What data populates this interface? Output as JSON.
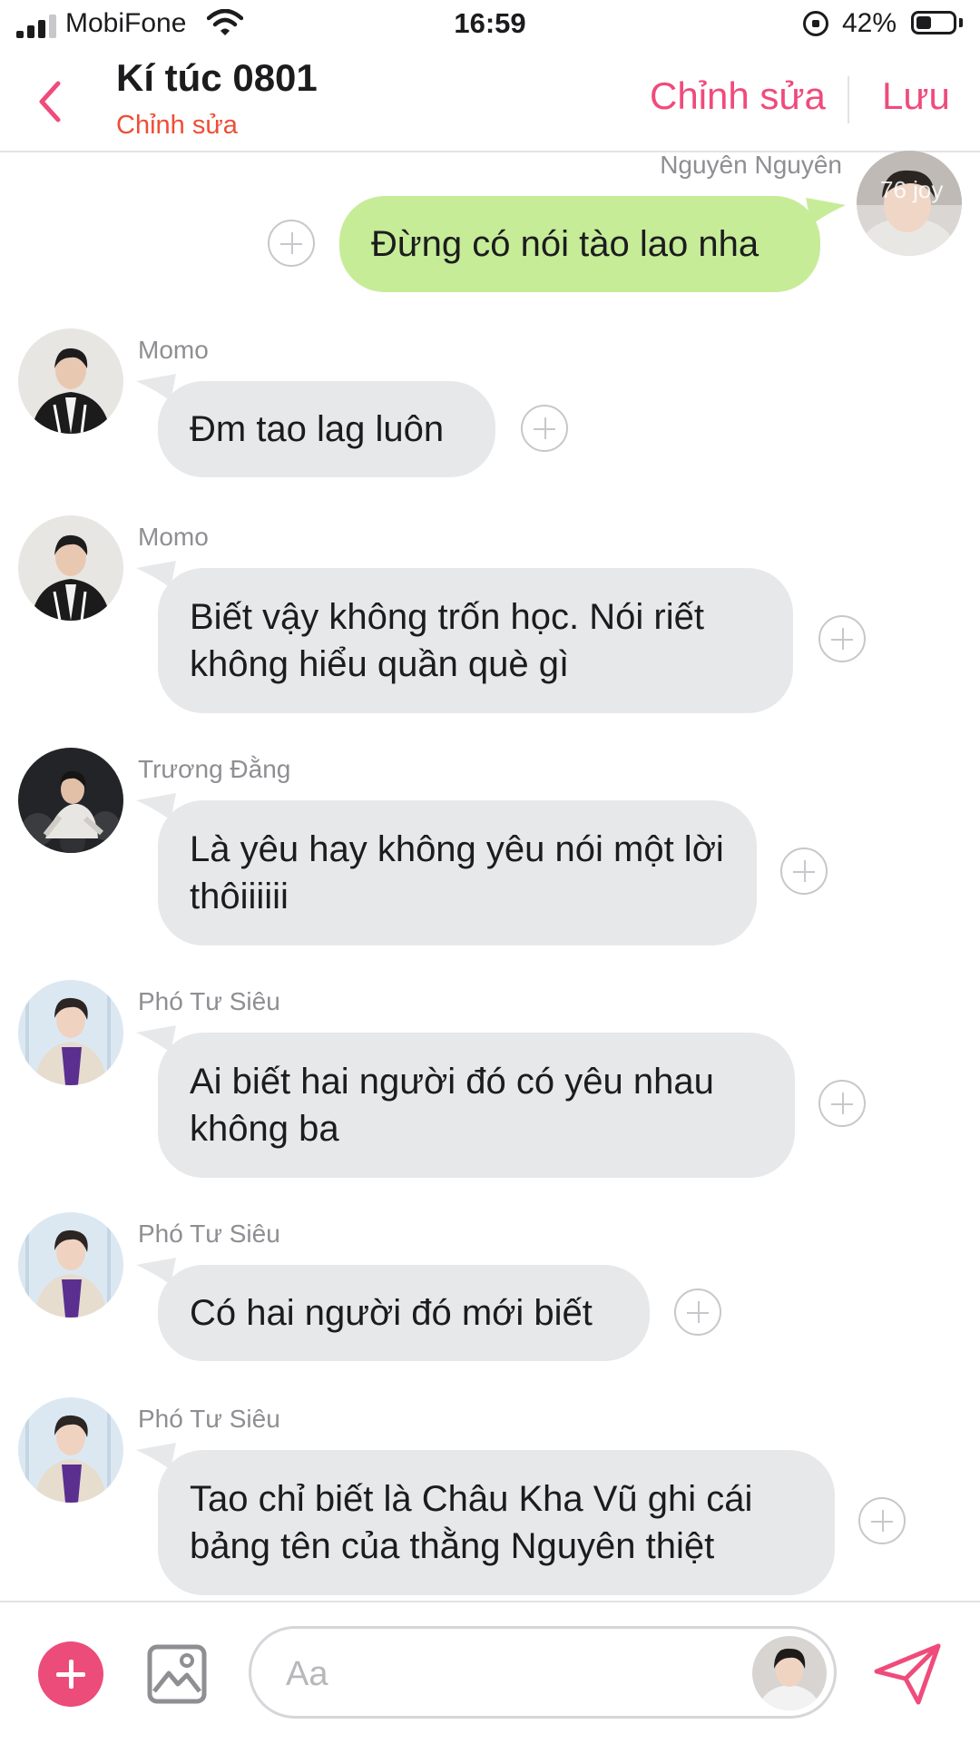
{
  "status_bar": {
    "carrier": "MobiFone",
    "time": "16:59",
    "battery_percent": "42%",
    "battery_level": 0.42
  },
  "header": {
    "title": "Kí túc 0801",
    "subtitle": "Chỉnh sửa",
    "edit_label": "Chỉnh sửa",
    "save_label": "Lưu",
    "accent_color": "#ef4b7b"
  },
  "messages": [
    {
      "sender": "Nguyên Nguyên",
      "text": "Đừng có nói tào lao nha",
      "outgoing": true,
      "avatar_watermark": "76 joy"
    },
    {
      "sender": "Momo",
      "text": "Đm tao lag luôn",
      "outgoing": false
    },
    {
      "sender": "Momo",
      "text": "Biết vậy không trốn học. Nói riết không hiểu quần què gì",
      "outgoing": false
    },
    {
      "sender": "Trương Đằng",
      "text": "Là yêu hay không yêu nói một lời thôiiiiii",
      "outgoing": false
    },
    {
      "sender": "Phó Tư Siêu",
      "text": "Ai biết hai người đó có yêu nhau không ba",
      "outgoing": false
    },
    {
      "sender": "Phó Tư Siêu",
      "text": "Có hai người đó mới biết",
      "outgoing": false
    },
    {
      "sender": "Phó Tư Siêu",
      "text": "Tao chỉ biết là Châu Kha Vũ ghi cái bảng tên của thằng Nguyên thiệt",
      "outgoing": false
    }
  ],
  "input": {
    "placeholder": "Aa",
    "value": ""
  },
  "icons": [
    "back-chevron-icon",
    "plus-icon",
    "image-icon",
    "send-icon",
    "add-reaction-icon"
  ]
}
